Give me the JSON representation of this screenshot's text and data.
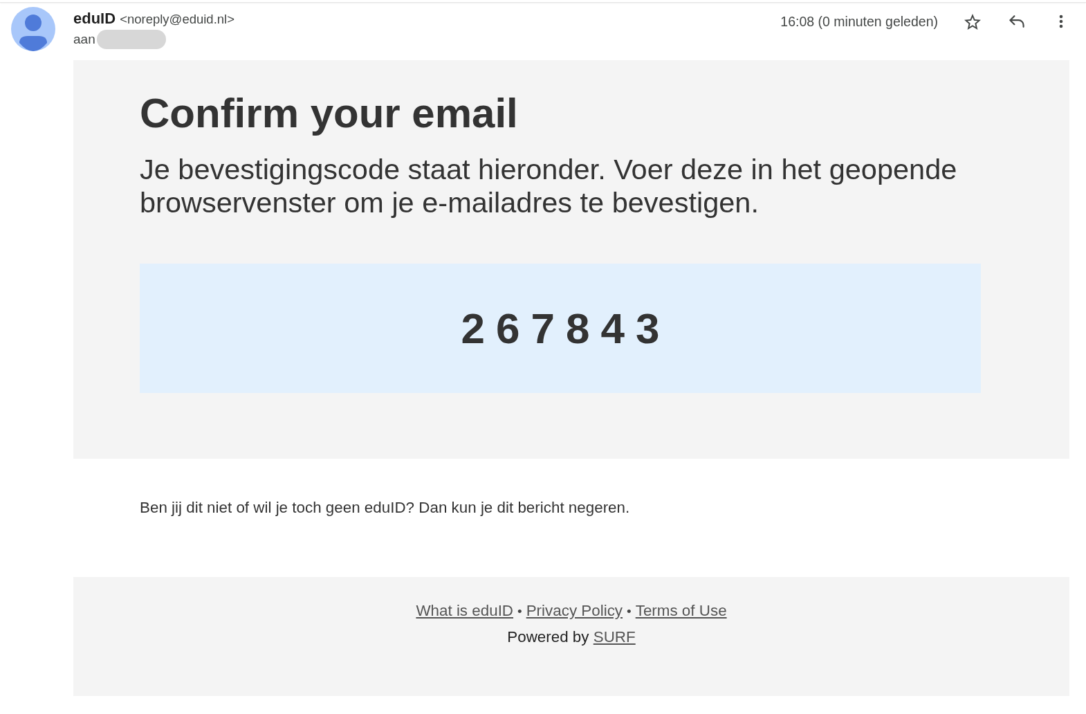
{
  "message_header": {
    "sender_name": "eduID",
    "sender_address": "<noreply@eduid.nl>",
    "recipient_label": "aan",
    "timestamp": "16:08 (0 minuten geleden)",
    "starred": false
  },
  "email_body": {
    "title": "Confirm your email",
    "intro": "Je bevestigingscode staat hieronder. Voer deze in het geopende browservenster om je e-mailadres te bevestigen.",
    "code": "267843",
    "notice": "Ben jij dit niet of wil je toch geen eduID? Dan kun je dit bericht negeren."
  },
  "footer": {
    "items": [
      {
        "kind": "link",
        "text": "What is eduID"
      },
      {
        "kind": "separator",
        "text": "•"
      },
      {
        "kind": "link",
        "text": "Privacy Policy"
      },
      {
        "kind": "separator",
        "text": "•"
      },
      {
        "kind": "link",
        "text": "Terms of Use"
      }
    ],
    "powered_by_label": "Powered by",
    "powered_by_link": "SURF"
  }
}
